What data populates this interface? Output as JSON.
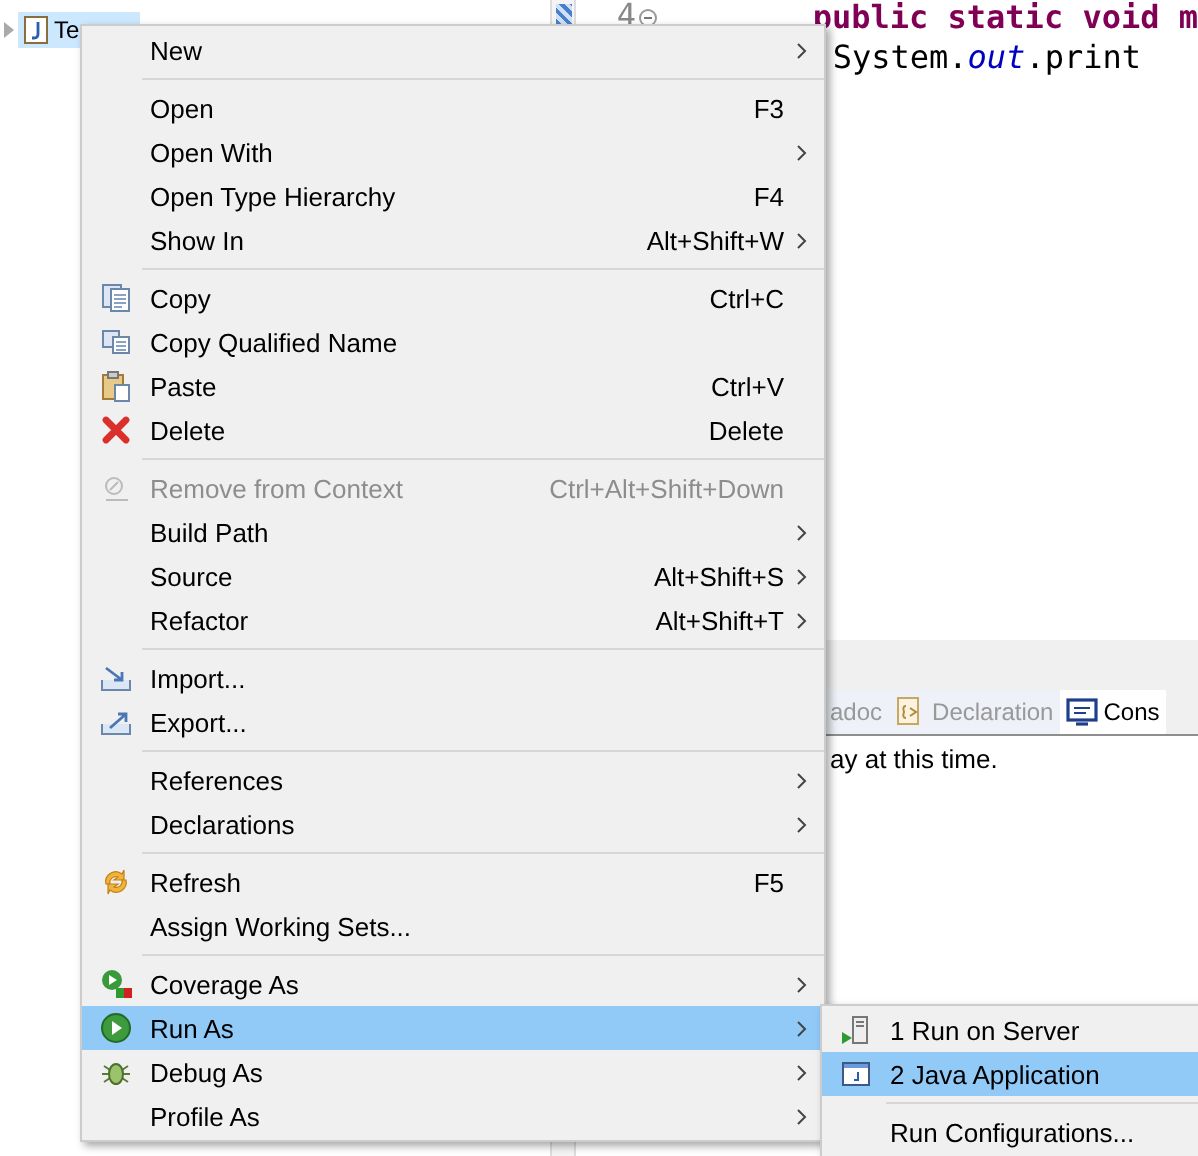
{
  "explorer": {
    "item": {
      "label": "Te",
      "selected": true
    }
  },
  "editor": {
    "line_number": "4",
    "lines": [
      {
        "kind": "keyword",
        "text": "public static void m"
      },
      {
        "kind": "call",
        "prefix": "System.",
        "field": "out",
        "suffix": ".print"
      }
    ]
  },
  "bottom_panel": {
    "tabs": [
      {
        "label": "adoc",
        "selected": false
      },
      {
        "label": "Declaration",
        "selected": false
      },
      {
        "label": "Cons",
        "selected": true
      }
    ],
    "message": "ay at this time."
  },
  "context_menu": {
    "items": [
      {
        "kind": "item",
        "label": "New",
        "submenu": true,
        "disabled": false,
        "selected": false
      },
      {
        "kind": "separator"
      },
      {
        "kind": "item",
        "label": "Open",
        "shortcut": "F3",
        "submenu": false,
        "disabled": false,
        "selected": false
      },
      {
        "kind": "item",
        "label": "Open With",
        "submenu": true,
        "disabled": false,
        "selected": false
      },
      {
        "kind": "item",
        "label": "Open Type Hierarchy",
        "shortcut": "F4",
        "submenu": false,
        "disabled": false,
        "selected": false
      },
      {
        "kind": "item",
        "label": "Show In",
        "shortcut": "Alt+Shift+W",
        "submenu": true,
        "disabled": false,
        "selected": false
      },
      {
        "kind": "separator"
      },
      {
        "kind": "item",
        "label": "Copy",
        "shortcut": "Ctrl+C",
        "submenu": false,
        "disabled": false,
        "selected": false
      },
      {
        "kind": "item",
        "label": "Copy Qualified Name",
        "submenu": false,
        "disabled": false,
        "selected": false
      },
      {
        "kind": "item",
        "label": "Paste",
        "shortcut": "Ctrl+V",
        "submenu": false,
        "disabled": false,
        "selected": false
      },
      {
        "kind": "item",
        "label": "Delete",
        "shortcut": "Delete",
        "submenu": false,
        "disabled": false,
        "selected": false
      },
      {
        "kind": "separator"
      },
      {
        "kind": "item",
        "label": "Remove from Context",
        "shortcut": "Ctrl+Alt+Shift+Down",
        "submenu": false,
        "disabled": true,
        "selected": false
      },
      {
        "kind": "item",
        "label": "Build Path",
        "submenu": true,
        "disabled": false,
        "selected": false
      },
      {
        "kind": "item",
        "label": "Source",
        "shortcut": "Alt+Shift+S",
        "submenu": true,
        "disabled": false,
        "selected": false
      },
      {
        "kind": "item",
        "label": "Refactor",
        "shortcut": "Alt+Shift+T",
        "submenu": true,
        "disabled": false,
        "selected": false
      },
      {
        "kind": "separator"
      },
      {
        "kind": "item",
        "label": "Import...",
        "submenu": false,
        "disabled": false,
        "selected": false
      },
      {
        "kind": "item",
        "label": "Export...",
        "submenu": false,
        "disabled": false,
        "selected": false
      },
      {
        "kind": "separator"
      },
      {
        "kind": "item",
        "label": "References",
        "submenu": true,
        "disabled": false,
        "selected": false
      },
      {
        "kind": "item",
        "label": "Declarations",
        "submenu": true,
        "disabled": false,
        "selected": false
      },
      {
        "kind": "separator"
      },
      {
        "kind": "item",
        "label": "Refresh",
        "shortcut": "F5",
        "submenu": false,
        "disabled": false,
        "selected": false
      },
      {
        "kind": "item",
        "label": "Assign Working Sets...",
        "submenu": false,
        "disabled": false,
        "selected": false
      },
      {
        "kind": "separator"
      },
      {
        "kind": "item",
        "label": "Coverage As",
        "submenu": true,
        "disabled": false,
        "selected": false
      },
      {
        "kind": "item",
        "label": "Run As",
        "submenu": true,
        "disabled": false,
        "selected": true
      },
      {
        "kind": "item",
        "label": "Debug As",
        "submenu": true,
        "disabled": false,
        "selected": false
      },
      {
        "kind": "item",
        "label": "Profile As",
        "submenu": true,
        "disabled": false,
        "selected": false
      }
    ]
  },
  "submenu": {
    "items": [
      {
        "kind": "item",
        "label": "1 Run on Server",
        "selected": false
      },
      {
        "kind": "item",
        "label": "2 Java Application",
        "selected": true
      },
      {
        "kind": "separator"
      },
      {
        "kind": "item",
        "label": "Run Configurations...",
        "selected": false
      }
    ]
  }
}
